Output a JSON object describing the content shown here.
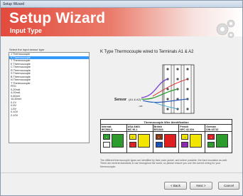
{
  "window": {
    "title": "Setup Wizard"
  },
  "banner": {
    "title": "Setup Wizard",
    "subtitle": "Input Type",
    "icon": "gears-icon"
  },
  "left": {
    "label": "Select the input sensor type",
    "items": [
      {
        "label": "J Thermocouple",
        "selected": false
      },
      {
        "label": "K Thermocouple",
        "selected": true
      },
      {
        "label": "T Thermocouple",
        "selected": false
      },
      {
        "label": "E Thermocouple",
        "selected": false
      },
      {
        "label": "C Thermocouple",
        "selected": false
      },
      {
        "label": "R Thermocouple",
        "selected": false
      },
      {
        "label": "S Thermocouple",
        "selected": false
      },
      {
        "label": "B Thermocouple",
        "selected": false
      },
      {
        "label": "N Thermocouple",
        "selected": false
      },
      {
        "label": "T Thermocouple",
        "selected": false
      },
      {
        "label": "RTD",
        "selected": false
      },
      {
        "label": "0-20mA",
        "selected": false
      },
      {
        "label": "4-20mA",
        "selected": false
      },
      {
        "label": "0-50mV",
        "selected": false
      },
      {
        "label": "10-50mV",
        "selected": false
      },
      {
        "label": "0-1V",
        "selected": false
      },
      {
        "label": "0-5V",
        "selected": false
      },
      {
        "label": "1-5V",
        "selected": false
      },
      {
        "label": "0-10V",
        "selected": false
      },
      {
        "label": "2-10V",
        "selected": false
      }
    ]
  },
  "main": {
    "heading": "K Type Thermocouple wired to Terminals A1 & A2",
    "wiring": {
      "sensor_label": "Sensor",
      "terminal_label": "(A1 & A2)",
      "neg_label": "-ve"
    },
    "table": {
      "title": "Thermocouple Wire Identification",
      "columns": [
        {
          "name": "Internat.",
          "std": "IEC584-3",
          "pos": "+",
          "neg": "-",
          "pos_color": "#2e9b2e",
          "neg_color": "#ffffff",
          "sheath": "#2e9b2e"
        },
        {
          "name": "USA ANSI",
          "std": "MC 96.1",
          "pos": "+",
          "neg": "-",
          "pos_color": "#f2e600",
          "neg_color": "#e02020",
          "sheath": "#f2e600"
        },
        {
          "name": "British",
          "std": "BS1843",
          "pos": "+",
          "neg": "-",
          "pos_color": "#8b3a1a",
          "neg_color": "#1a4fb4",
          "sheath": "#e02020"
        },
        {
          "name": "French",
          "std": "NFC 42-324",
          "pos": "+",
          "neg": "-",
          "pos_color": "#f2e600",
          "neg_color": "#8a28b0",
          "sheath": "#f2e600"
        },
        {
          "name": "German",
          "std": "DIN 43710",
          "pos": "+",
          "neg": "-",
          "pos_color": "#e02020",
          "neg_color": "#2e9b2e",
          "sheath": "#2e9b2e"
        }
      ]
    },
    "info": "The different thermocouple types are identified by their outer jacket, and where possible, the bare insulation as well. There are several standards in use throughout the world, so please ensure you use the correct wiring for your thermocouple."
  },
  "buttons": {
    "back": "< Back",
    "next": "Next >",
    "cancel": "Cancel"
  },
  "colors": {
    "banner_red": "#e24a3c",
    "selection": "#3399ff",
    "border": "#8e8f8f"
  }
}
